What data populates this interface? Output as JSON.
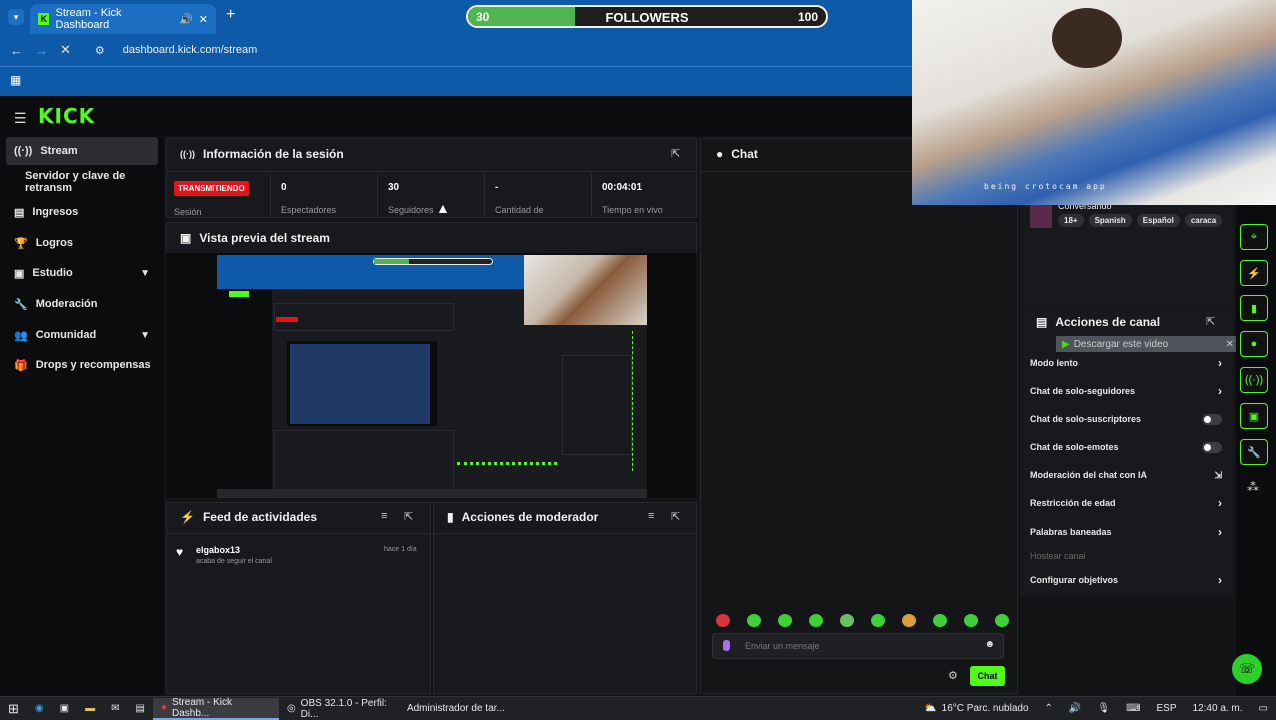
{
  "browser": {
    "tab_title": "Stream - Kick Dashboard",
    "new_tab": "+",
    "url": "dashboard.kick.com/stream"
  },
  "followers_goal": {
    "current": "30",
    "label": "FOLLOWERS",
    "target": "100",
    "progress": 0.3
  },
  "kick": {
    "logo": "KICK",
    "sidebar": [
      {
        "label": "Stream",
        "icon": "broadcast-icon"
      },
      {
        "label": "Servidor y clave de retransm"
      },
      {
        "label": "Ingresos",
        "icon": "money-icon"
      },
      {
        "label": "Logros",
        "icon": "trophy-icon"
      },
      {
        "label": "Estudio",
        "icon": "studio-icon"
      },
      {
        "label": "Moderación",
        "icon": "wrench-icon"
      },
      {
        "label": "Comunidad",
        "icon": "people-icon"
      },
      {
        "label": "Drops y recompensas",
        "icon": "gift-icon"
      }
    ]
  },
  "session": {
    "title": "Información de la sesión",
    "badge": "TRANSMITIENDO",
    "badge_sub": "Sesión",
    "stats": [
      {
        "value": "0",
        "label": "Espectadores"
      },
      {
        "value": "30",
        "label": "Seguidores"
      },
      {
        "value": "-",
        "label": "Cantidad de"
      },
      {
        "value": "00:04:01",
        "label": "Tiempo en vivo"
      }
    ]
  },
  "preview": {
    "title": "Vista previa del stream"
  },
  "activity": {
    "title": "Feed de actividades",
    "items": [
      {
        "user": "elgabox13",
        "text": "acaba de seguir el canal",
        "time": "hace 1 día"
      }
    ]
  },
  "mod_actions": {
    "title": "Acciones de moderador"
  },
  "chat": {
    "title": "Chat",
    "placeholder": "Enviar un mensaje",
    "send": "Chat"
  },
  "stream_info": {
    "status": "Conversando",
    "tags": [
      "18+",
      "Spanish",
      "Español",
      "caraca"
    ]
  },
  "channel_actions": {
    "title": "Acciones de canal",
    "download_overlay": "Descargar este video",
    "items": [
      {
        "label": "Modo lento",
        "control": "arrow"
      },
      {
        "label": "Chat de solo-seguidores",
        "control": "arrow"
      },
      {
        "label": "Chat de solo-suscriptores",
        "control": "toggle"
      },
      {
        "label": "Chat de solo-emotes",
        "control": "toggle"
      },
      {
        "label": "Moderación del chat con IA",
        "control": "external"
      },
      {
        "label": "Restricción de edad",
        "control": "arrow"
      },
      {
        "label": "Palabras baneadas",
        "control": "arrow"
      },
      {
        "label": "Hostear canal",
        "control": "none"
      },
      {
        "label": "Configurar objetivos",
        "control": "arrow"
      }
    ]
  },
  "webcam": {
    "watermark": "being crotocam app"
  },
  "taskbar": {
    "apps": [
      "Stream - Kick Dashb...",
      "OBS 32.1.0 - Perfil: Di...",
      "Administrador de tar..."
    ],
    "weather": "16°C  Parc. nublado",
    "lang": "ESP",
    "time": "12:40 a. m."
  }
}
